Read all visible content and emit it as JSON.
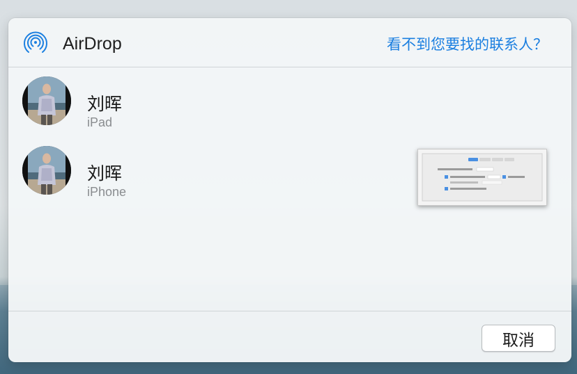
{
  "dialog": {
    "title": "AirDrop",
    "help_link": "看不到您要找的联系人？",
    "cancel_label": "取消"
  },
  "contacts": [
    {
      "name": "刘晖",
      "device": "iPad"
    },
    {
      "name": "刘晖",
      "device": "iPhone"
    }
  ],
  "colors": {
    "accent": "#1b7fe0",
    "text_primary": "#1a1a1a",
    "text_secondary": "#8a8d90"
  },
  "icons": {
    "airdrop": "airdrop-icon",
    "avatar": "avatar"
  }
}
